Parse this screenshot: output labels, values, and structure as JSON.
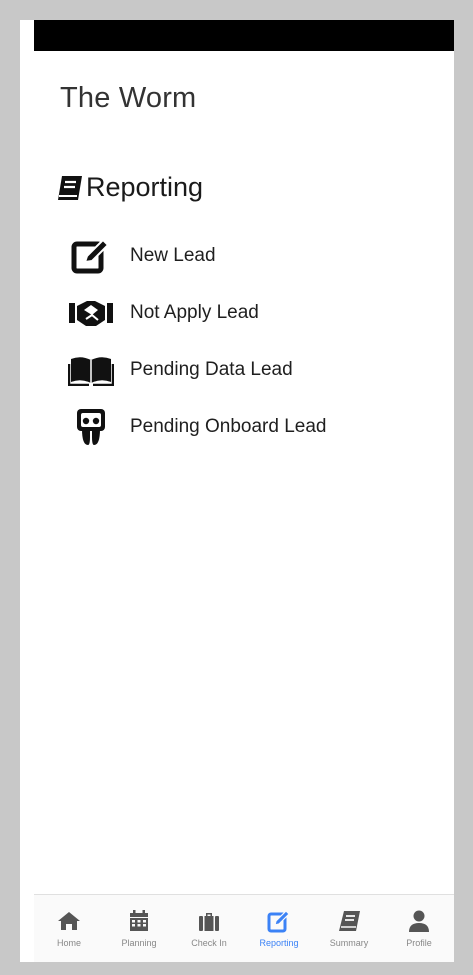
{
  "app": {
    "title": "The Worm"
  },
  "section": {
    "title": "Reporting",
    "icon": "book-icon"
  },
  "menu": [
    {
      "label": "New Lead",
      "icon": "edit-icon"
    },
    {
      "label": "Not Apply Lead",
      "icon": "handshake-icon"
    },
    {
      "label": "Pending Data Lead",
      "icon": "open-book-icon"
    },
    {
      "label": "Pending Onboard Lead",
      "icon": "slideshare-icon"
    }
  ],
  "nav": [
    {
      "label": "Home",
      "icon": "home-icon"
    },
    {
      "label": "Planning",
      "icon": "calendar-icon"
    },
    {
      "label": "Check In",
      "icon": "suitcase-icon"
    },
    {
      "label": "Reporting",
      "icon": "edit-icon",
      "active": true
    },
    {
      "label": "Summary",
      "icon": "book-icon"
    },
    {
      "label": "Profile",
      "icon": "user-icon"
    }
  ],
  "colors": {
    "accent": "#3b82f6",
    "nav_inactive": "#555555",
    "status_bar": "#000000"
  }
}
